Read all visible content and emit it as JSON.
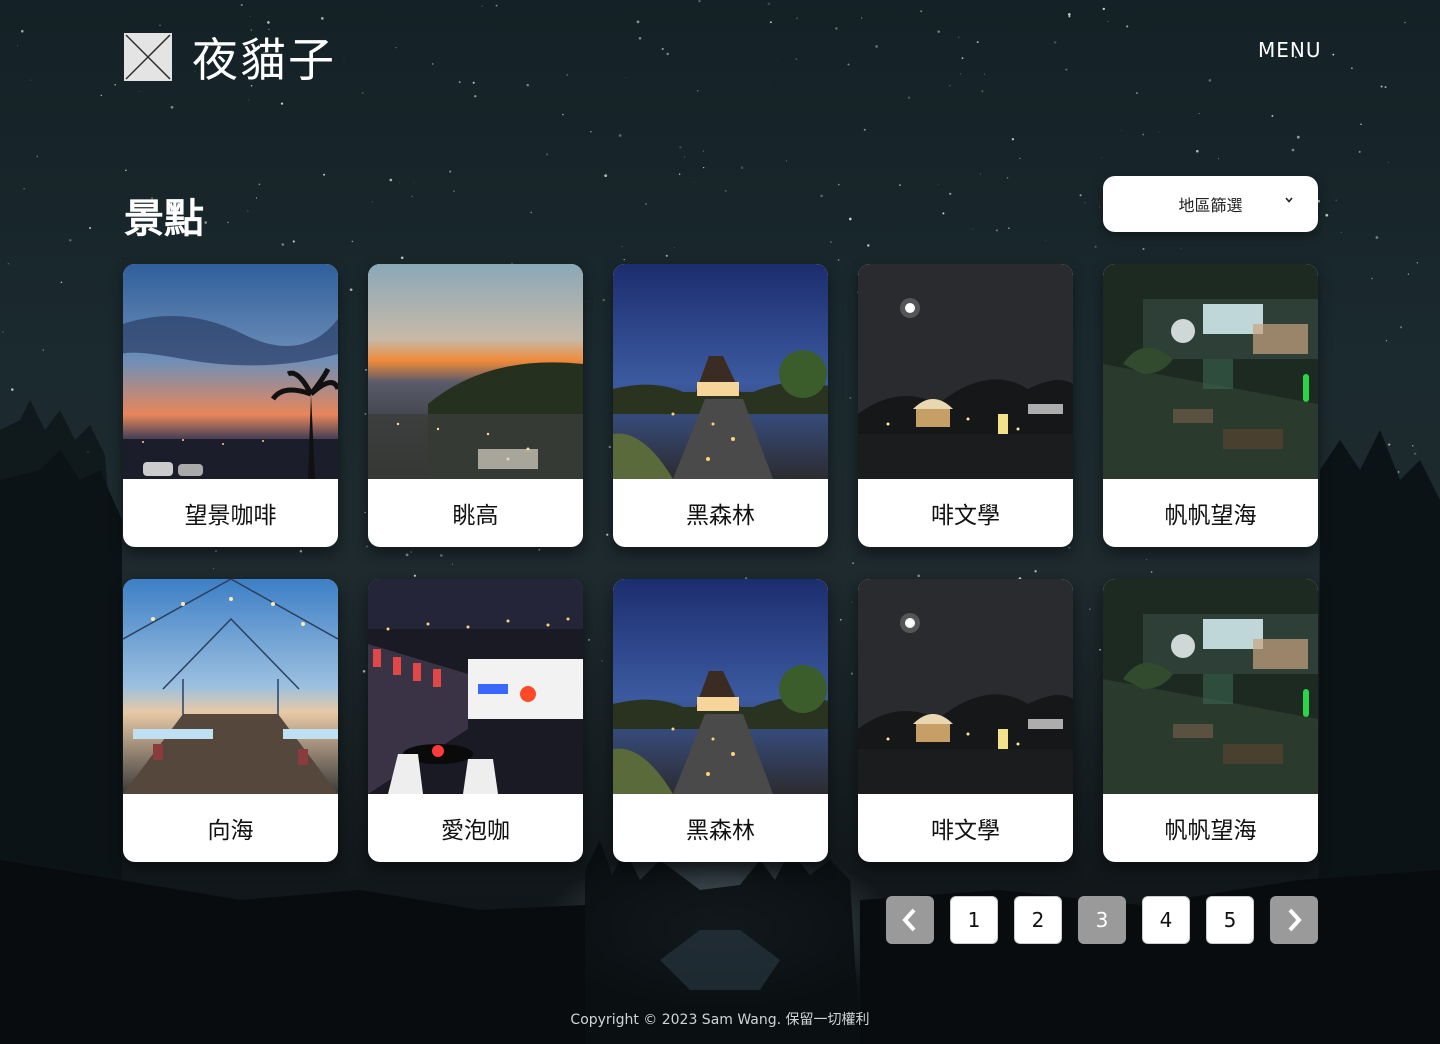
{
  "header": {
    "logo_text": "夜貓子",
    "menu_label": "MENU"
  },
  "page": {
    "title": "景點"
  },
  "filter": {
    "label": "地區篩選"
  },
  "cards": [
    {
      "name": "望景咖啡",
      "scene": "sunset-view"
    },
    {
      "name": "眺高",
      "scene": "dusk-hill"
    },
    {
      "name": "黑森林",
      "scene": "a-frame-night"
    },
    {
      "name": "啡文學",
      "scene": "moon-gazebo"
    },
    {
      "name": "帆帆望海",
      "scene": "cafe-facade"
    },
    {
      "name": "向海",
      "scene": "canopy-deck"
    },
    {
      "name": "愛泡咖",
      "scene": "terrace-lights"
    },
    {
      "name": "黑森林",
      "scene": "a-frame-night"
    },
    {
      "name": "啡文學",
      "scene": "moon-gazebo"
    },
    {
      "name": "帆帆望海",
      "scene": "cafe-facade"
    }
  ],
  "pagination": {
    "pages": [
      "1",
      "2",
      "3",
      "4",
      "5"
    ],
    "current": "3",
    "prev_icon": "chevron-left-icon",
    "next_icon": "chevron-right-icon"
  },
  "footer": {
    "copyright": "Copyright © 2023 Sam Wang. 保留一切權利"
  }
}
